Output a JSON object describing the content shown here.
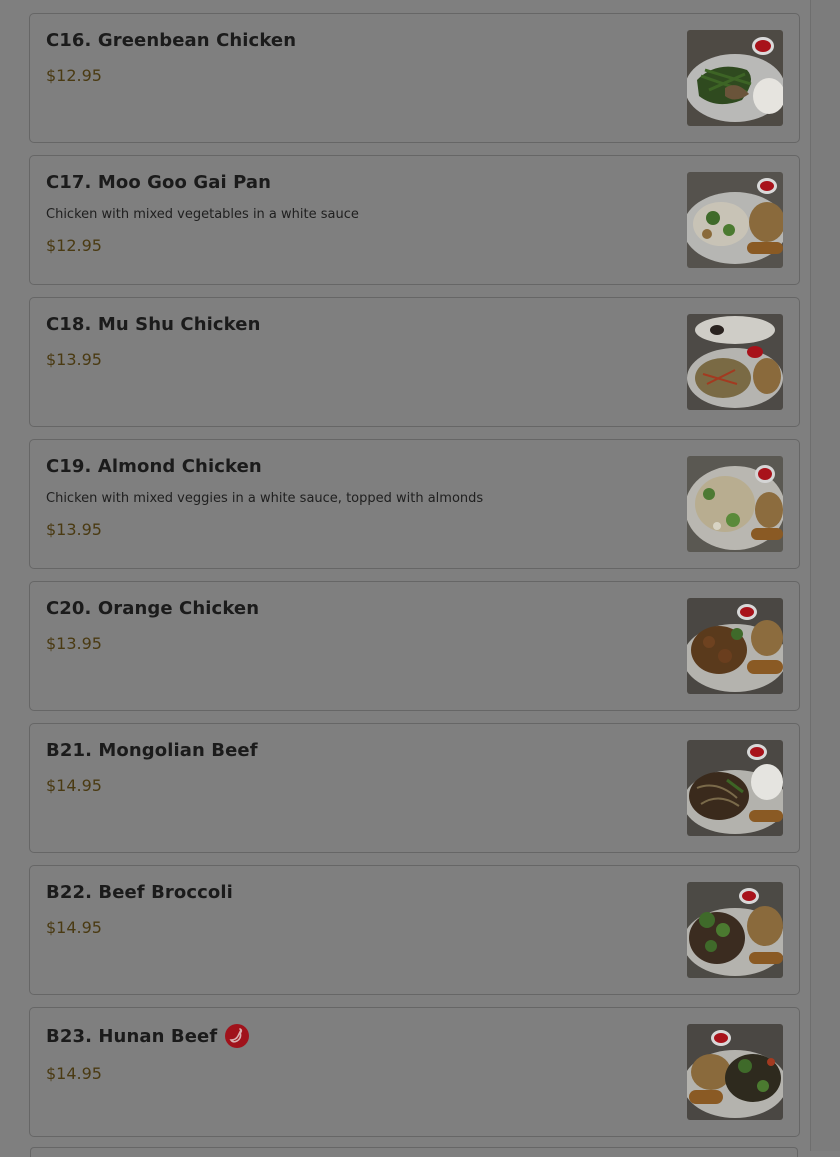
{
  "menu": {
    "items": [
      {
        "name": "C16. Greenbean Chicken",
        "description": "",
        "price": "$12.95",
        "spicy": false,
        "photo": "green-beans"
      },
      {
        "name": "C17. Moo Goo Gai Pan",
        "description": "Chicken with mixed vegetables in a white sauce",
        "price": "$12.95",
        "spicy": false,
        "photo": "mixed-veg"
      },
      {
        "name": "C18. Mu Shu Chicken",
        "description": "",
        "price": "$13.95",
        "spicy": false,
        "photo": "mu-shu"
      },
      {
        "name": "C19. Almond Chicken",
        "description": "Chicken with mixed veggies in a white sauce, topped with almonds",
        "price": "$13.95",
        "spicy": false,
        "photo": "almond"
      },
      {
        "name": "C20. Orange Chicken",
        "description": "",
        "price": "$13.95",
        "spicy": false,
        "photo": "orange"
      },
      {
        "name": "B21. Mongolian Beef",
        "description": "",
        "price": "$14.95",
        "spicy": false,
        "photo": "mongolian"
      },
      {
        "name": "B22. Beef Broccoli",
        "description": "",
        "price": "$14.95",
        "spicy": false,
        "photo": "broccoli"
      },
      {
        "name": "B23. Hunan Beef",
        "description": "",
        "price": "$14.95",
        "spicy": true,
        "photo": "hunan"
      }
    ]
  },
  "colors": {
    "overlay": "#7f7f7f",
    "card_border": "#666666",
    "price": "#4a3a12",
    "spicy_badge": "#a0121b"
  }
}
